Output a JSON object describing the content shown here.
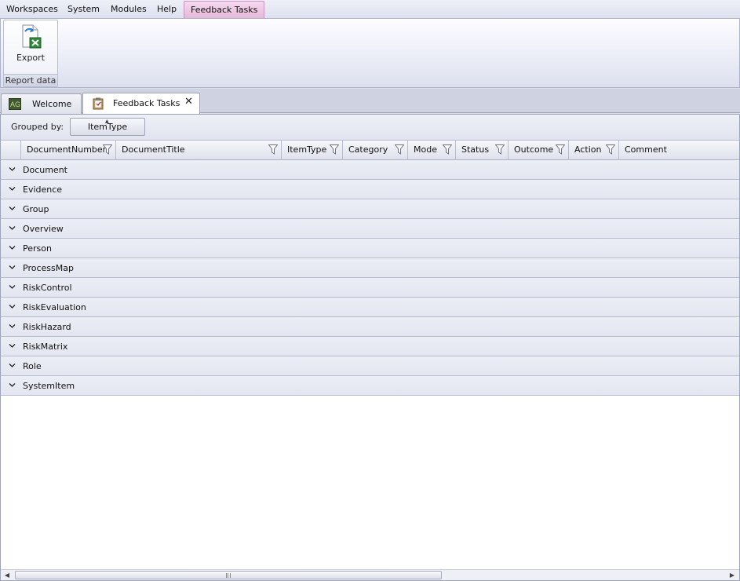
{
  "menubar": {
    "items": [
      "Workspaces",
      "System",
      "Modules",
      "Help"
    ],
    "context_tab": "Feedback Tasks"
  },
  "ribbon": {
    "export_label": "Export",
    "export_icon": "excel-export-icon",
    "group_label": "Report data"
  },
  "tabs": {
    "welcome": {
      "label": "Welcome",
      "icon": "ag-logo-icon"
    },
    "feedback": {
      "label": "Feedback Tasks",
      "icon": "clipboard-icon",
      "close": "✕"
    }
  },
  "grid": {
    "grouped_by_label": "Grouped by:",
    "grouped_by_value": "ItemType",
    "columns": [
      "DocumentNumber",
      "DocumentTitle",
      "ItemType",
      "Category",
      "Mode",
      "Status",
      "Outcome",
      "Action",
      "Comment"
    ],
    "groups": [
      "Document",
      "Evidence",
      "Group",
      "Overview",
      "Person",
      "ProcessMap",
      "RiskControl",
      "RiskEvaluation",
      "RiskHazard",
      "RiskMatrix",
      "Role",
      "SystemItem"
    ]
  },
  "colors": {
    "context_tab_bg": "#e6b8d8",
    "group_row_bg": "#e3e6f0",
    "header_bg": "#dfe2ec"
  }
}
